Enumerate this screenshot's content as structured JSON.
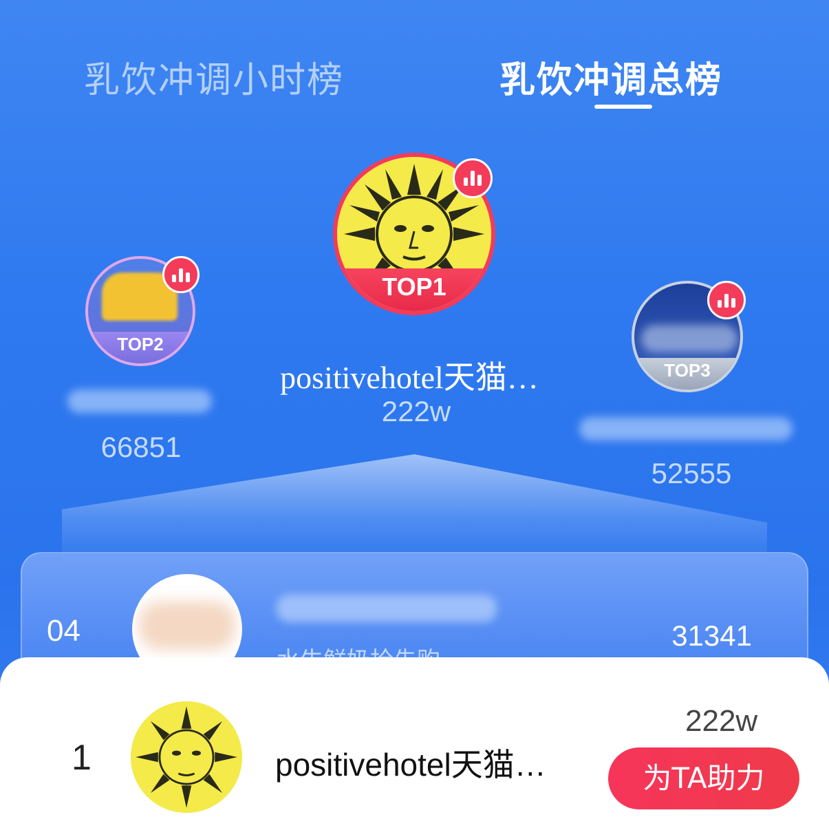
{
  "tabs": {
    "hourly": "乳饮冲调小时榜",
    "total": "乳饮冲调总榜"
  },
  "podium": {
    "first": {
      "rank_label": "TOP1",
      "name": "positivehotel天猫…",
      "score": "222w"
    },
    "second": {
      "rank_label": "TOP2",
      "name": "",
      "score": "66851"
    },
    "third": {
      "rank_label": "TOP3",
      "name": "",
      "score": "52555"
    }
  },
  "list": [
    {
      "rank": "04",
      "name": "",
      "subtitle": "水牛鲜奶抢先购",
      "score": "31341"
    }
  ],
  "my_store": {
    "rank": "1",
    "name": "positivehotel天猫…",
    "score": "222w",
    "help_button": "为TA助力"
  },
  "icons": {
    "hot_badge": "bar-chart-icon",
    "store_logo": "sun-face-logo"
  },
  "colors": {
    "background": "#2f7af0",
    "badge": "#f43b5a",
    "button": "#f6355a"
  }
}
